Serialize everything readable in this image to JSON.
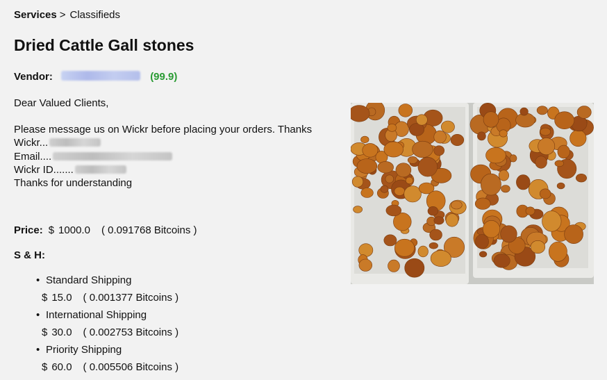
{
  "breadcrumb": {
    "root": "Services",
    "separator": ">",
    "current": "Classifieds"
  },
  "title": "Dried Cattle Gall stones",
  "vendor": {
    "label": "Vendor:",
    "rating": "(99.9)"
  },
  "description": {
    "greeting": "Dear Valued Clients,",
    "line1": "Please message us on Wickr before placing your orders. Thanks",
    "wickr_label": "Wickr...",
    "email_label": "Email....",
    "wickr_id_label": "Wickr ID.......",
    "closing": "Thanks for understanding"
  },
  "price": {
    "label": "Price:",
    "currency": "$",
    "amount": "1000.0",
    "btc": "( 0.091768 Bitcoins )"
  },
  "shipping": {
    "label": "S & H:",
    "options": [
      {
        "name": "Standard Shipping",
        "currency": "$",
        "amount": "15.0",
        "btc": "( 0.001377 Bitcoins )"
      },
      {
        "name": "International Shipping",
        "currency": "$",
        "amount": "30.0",
        "btc": "( 0.002753 Bitcoins )"
      },
      {
        "name": "Priority Shipping",
        "currency": "$",
        "amount": "60.0",
        "btc": "( 0.005506 Bitcoins )"
      }
    ]
  },
  "colors": {
    "rating_green": "#2a9b34",
    "background": "#f2f2f2"
  }
}
